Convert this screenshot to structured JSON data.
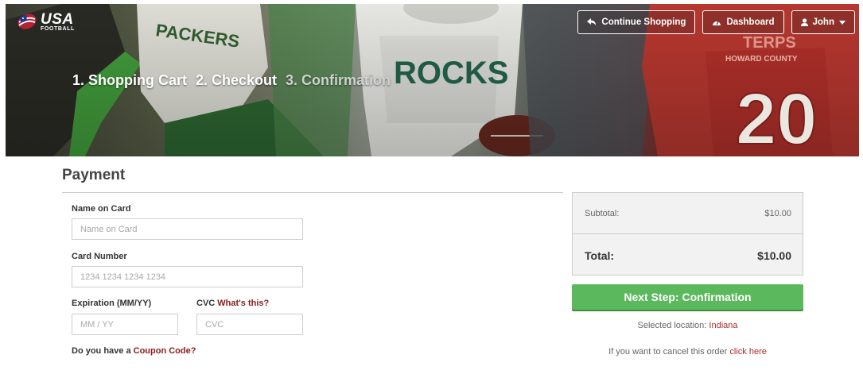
{
  "brand": {
    "name": "USA",
    "sub": "FOOTBALL"
  },
  "steps": [
    {
      "label": "1. Shopping Cart"
    },
    {
      "label": "2. Checkout"
    },
    {
      "label": "3. Confirmation"
    }
  ],
  "nav": {
    "continue_shopping": "Continue Shopping",
    "dashboard": "Dashboard",
    "user": "John"
  },
  "hero_text": {
    "jersey1": "PACKERS",
    "jersey2": "ROCKS",
    "jersey3": "TERPS",
    "jersey3_sub": "HOWARD COUNTY",
    "jersey3_number": "20"
  },
  "payment": {
    "title": "Payment",
    "name_label": "Name on Card",
    "name_placeholder": "Name on Card",
    "card_label": "Card Number",
    "card_placeholder": "1234 1234 1234 1234",
    "exp_label": "Expiration (MM/YY)",
    "exp_placeholder": "MM / YY",
    "cvc_label": "CVC",
    "cvc_link": "What's this?",
    "cvc_placeholder": "CVC",
    "coupon_prefix": "Do you have a",
    "coupon_link": "Coupon Code?"
  },
  "summary": {
    "subtotal_label": "Subtotal:",
    "subtotal_value": "$10.00",
    "total_label": "Total:",
    "total_value": "$10.00"
  },
  "next_button": "Next Step: Confirmation",
  "location": {
    "prefix": "Selected location:",
    "value": "Indiana"
  },
  "cancel": {
    "prefix": "If you want to cancel this order",
    "link": "click here"
  },
  "colors": {
    "primary_green": "#5cb85c",
    "link_red": "#8b1a1a"
  }
}
